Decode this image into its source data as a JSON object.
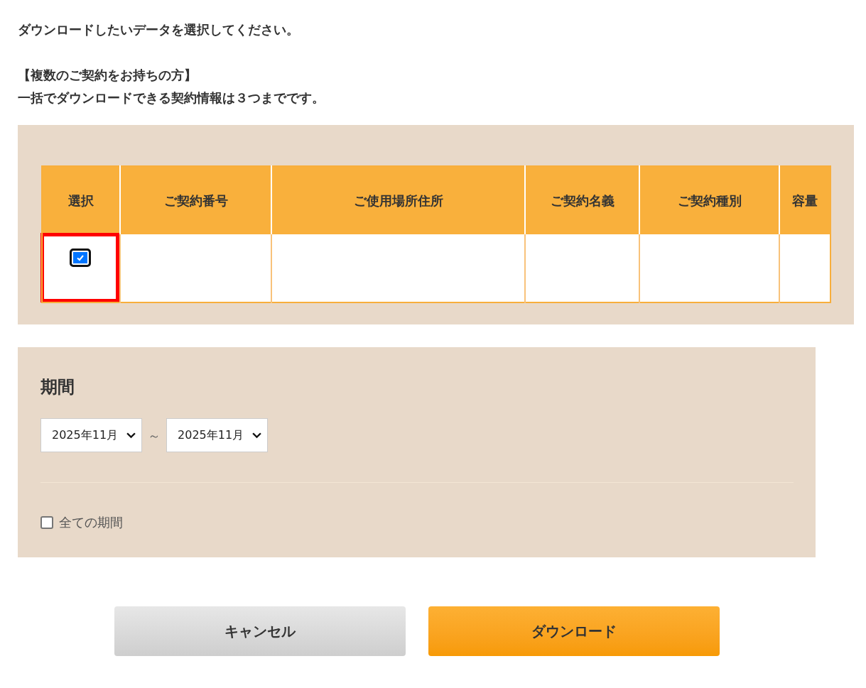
{
  "intro": {
    "lines": [
      "ダウンロードしたいデータを選択してください。"
    ],
    "notice_title": "【複数のご契約をお持ちの方】",
    "notice_text": "一括でダウンロードできる契約情報は３つまでです。"
  },
  "table": {
    "columns": [
      "選択",
      "ご契約番号",
      "ご使用場所住所",
      "ご契約名義",
      "ご契約種別",
      "容量"
    ],
    "rows": [
      {
        "selected": true,
        "highlighted": true
      }
    ]
  },
  "period": {
    "title": "期間",
    "from": "2025年11月",
    "separator": "～",
    "to": "2025年11月",
    "all_periods": {
      "label": "全ての期間",
      "checked": false
    }
  },
  "buttons": [
    {
      "label": "キャンセル",
      "kind": "secondary"
    },
    {
      "label": "ダウンロード",
      "kind": "primary"
    }
  ]
}
